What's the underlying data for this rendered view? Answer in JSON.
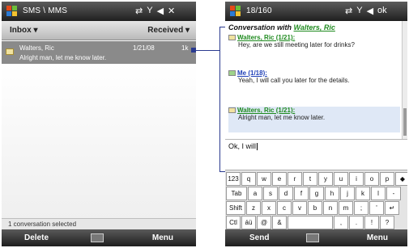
{
  "left": {
    "titlebar": {
      "title": "SMS \\ MMS",
      "icons": [
        "⇄",
        "Y",
        "◀",
        "✕"
      ]
    },
    "header": {
      "folder": "Inbox ▾",
      "sort": "Received ▾"
    },
    "message": {
      "from": "Walters, Ric",
      "date": "1/21/08",
      "size": "1k",
      "preview": "Alright man, let me know later."
    },
    "status": "1 conversation selected",
    "softkeys": {
      "left": "Delete",
      "right": "Menu"
    }
  },
  "right": {
    "titlebar": {
      "title": "18/160",
      "icons": [
        "⇄",
        "Y",
        "◀",
        "ok"
      ]
    },
    "conversation": {
      "title_prefix": "Conversation with",
      "title_contact": "Walters, Ric",
      "messages": [
        {
          "head": "Walters, Ric (1/21):",
          "body": "Hey, are we still meeting later for drinks?"
        },
        {
          "head": "Me (1/18):",
          "body": "Yeah, I will call you later for the details."
        },
        {
          "head": "Walters, Ric (1/21):",
          "body": "Alright man, let me know later."
        }
      ]
    },
    "reply_text": "Ok, I will",
    "keyboard": {
      "row1": [
        "123",
        "q",
        "w",
        "e",
        "r",
        "t",
        "y",
        "u",
        "i",
        "o",
        "p",
        "◆"
      ],
      "row2": [
        "Tab",
        "a",
        "s",
        "d",
        "f",
        "g",
        "h",
        "j",
        "k",
        "l",
        "-"
      ],
      "row3": [
        "Shift",
        "z",
        "x",
        "c",
        "v",
        "b",
        "n",
        "m",
        ";",
        "'",
        "↵"
      ],
      "row4": [
        "Ctl",
        "áü",
        "@",
        "&",
        " ",
        ",",
        ".",
        "!",
        "?"
      ]
    },
    "softkeys": {
      "left": "Send",
      "right": "Menu"
    }
  },
  "colors": {
    "titlebar": "#2e2e2e",
    "selected_row": "#8a8a8a",
    "incoming": "#1e8a1e",
    "outgoing": "#2242b8",
    "connector": "#2a3a8f"
  }
}
